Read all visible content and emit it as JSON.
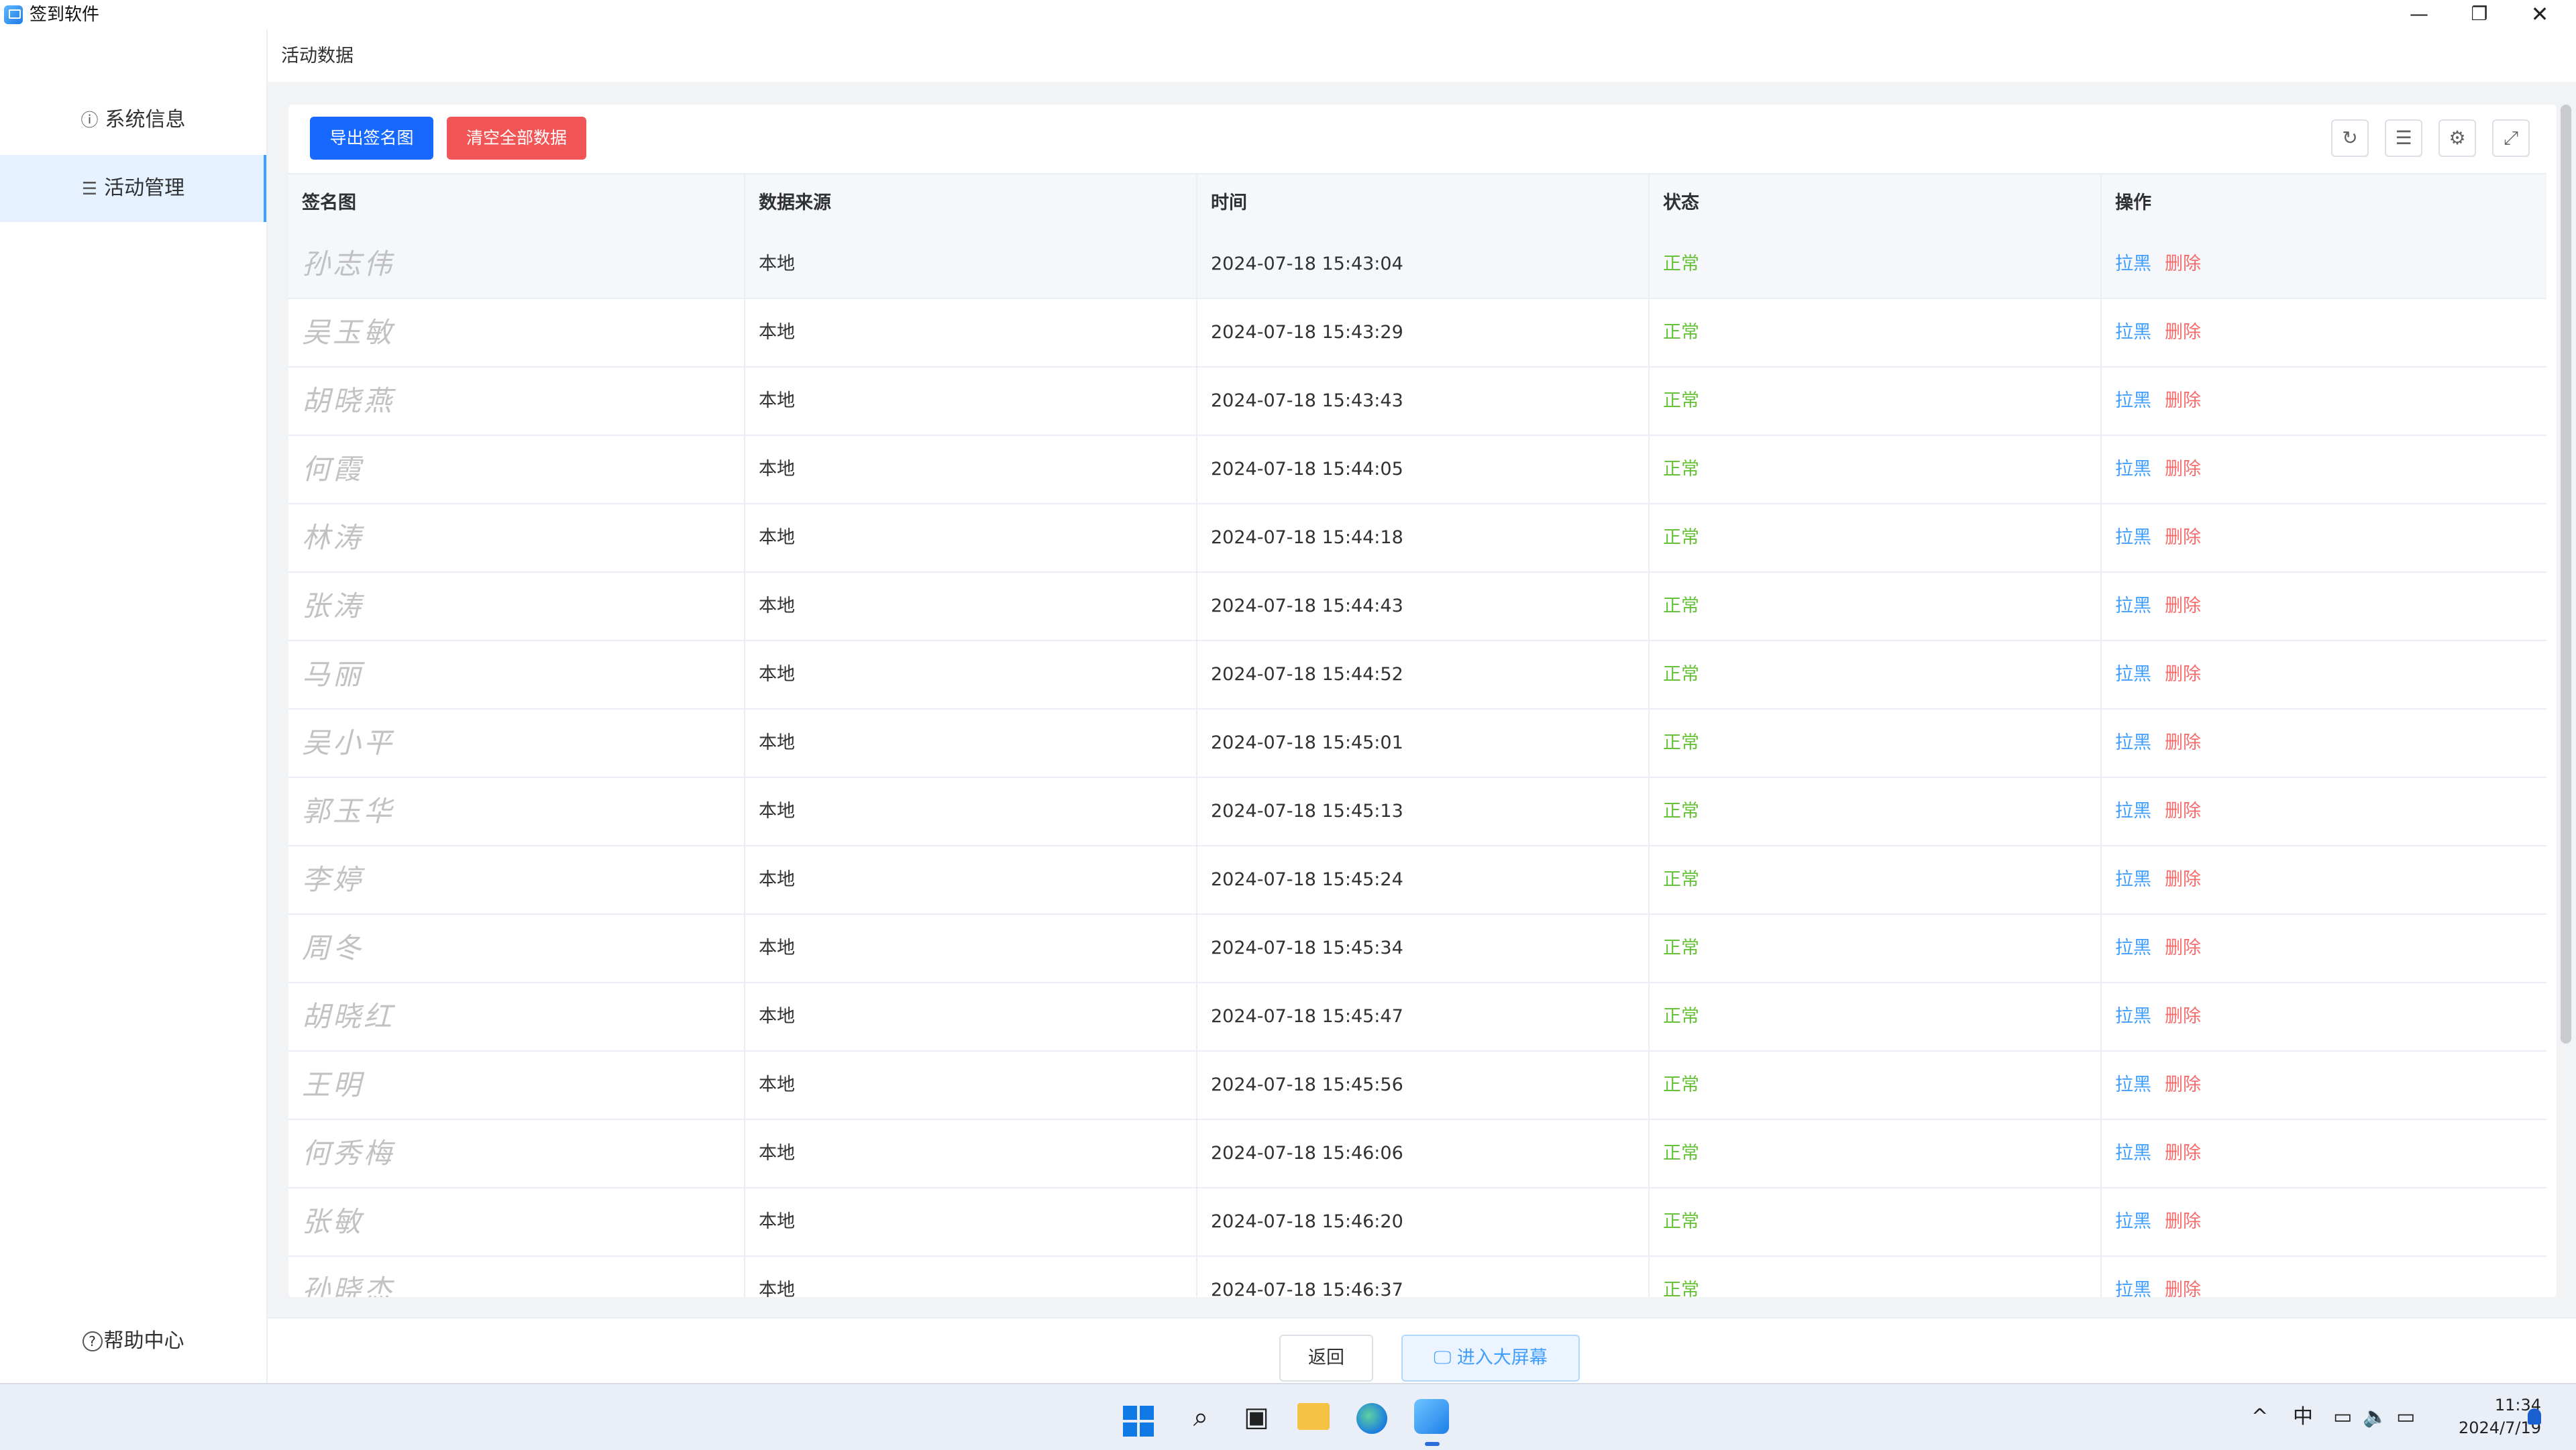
{
  "window": {
    "title": "签到软件",
    "controls": [
      "—",
      "❐",
      "✕"
    ]
  },
  "sidebar": {
    "items": [
      {
        "label": "系统信息",
        "icon": "info-icon",
        "active": false
      },
      {
        "label": "活动管理",
        "icon": "list-icon",
        "active": true
      }
    ],
    "help": {
      "label": "帮助中心",
      "icon": "help-icon"
    }
  },
  "breadcrumb": {
    "label": "活动数据"
  },
  "toolbar": {
    "export_label": "导出签名图",
    "clear_label": "清空全部数据",
    "tools": [
      "refresh-icon",
      "density-icon",
      "settings-icon",
      "fullscreen-icon"
    ]
  },
  "table": {
    "columns": [
      "签名图",
      "数据来源",
      "时间",
      "状态",
      "操作"
    ],
    "action_blacklist": "拉黑",
    "action_delete": "删除",
    "rows": [
      {
        "signature": "孙志伟",
        "source": "本地",
        "time": "2024-07-18 15:43:04",
        "status": "正常"
      },
      {
        "signature": "吴玉敏",
        "source": "本地",
        "time": "2024-07-18 15:43:29",
        "status": "正常"
      },
      {
        "signature": "胡晓燕",
        "source": "本地",
        "time": "2024-07-18 15:43:43",
        "status": "正常"
      },
      {
        "signature": "何霞",
        "source": "本地",
        "time": "2024-07-18 15:44:05",
        "status": "正常"
      },
      {
        "signature": "林涛",
        "source": "本地",
        "time": "2024-07-18 15:44:18",
        "status": "正常"
      },
      {
        "signature": "张涛",
        "source": "本地",
        "time": "2024-07-18 15:44:43",
        "status": "正常"
      },
      {
        "signature": "马丽",
        "source": "本地",
        "time": "2024-07-18 15:44:52",
        "status": "正常"
      },
      {
        "signature": "吴小平",
        "source": "本地",
        "time": "2024-07-18 15:45:01",
        "status": "正常"
      },
      {
        "signature": "郭玉华",
        "source": "本地",
        "time": "2024-07-18 15:45:13",
        "status": "正常"
      },
      {
        "signature": "李婷",
        "source": "本地",
        "time": "2024-07-18 15:45:24",
        "status": "正常"
      },
      {
        "signature": "周冬",
        "source": "本地",
        "time": "2024-07-18 15:45:34",
        "status": "正常"
      },
      {
        "signature": "胡晓红",
        "source": "本地",
        "time": "2024-07-18 15:45:47",
        "status": "正常"
      },
      {
        "signature": "王明",
        "source": "本地",
        "time": "2024-07-18 15:45:56",
        "status": "正常"
      },
      {
        "signature": "何秀梅",
        "source": "本地",
        "time": "2024-07-18 15:46:06",
        "status": "正常"
      },
      {
        "signature": "张敏",
        "source": "本地",
        "time": "2024-07-18 15:46:20",
        "status": "正常"
      },
      {
        "signature": "孙晓杰",
        "source": "本地",
        "time": "2024-07-18 15:46:37",
        "status": "正常"
      }
    ]
  },
  "footer": {
    "back_label": "返回",
    "bigscreen_label": "进入大屏幕",
    "bigscreen_icon": "monitor-icon"
  },
  "taskbar": {
    "apps": [
      "start-icon",
      "search-icon",
      "task-view-icon",
      "file-explorer-icon",
      "edge-icon",
      "signin-app-icon"
    ],
    "tray": {
      "chevron": "^",
      "ime": "中"
    },
    "time": "11:34",
    "date": "2024/7/19"
  }
}
